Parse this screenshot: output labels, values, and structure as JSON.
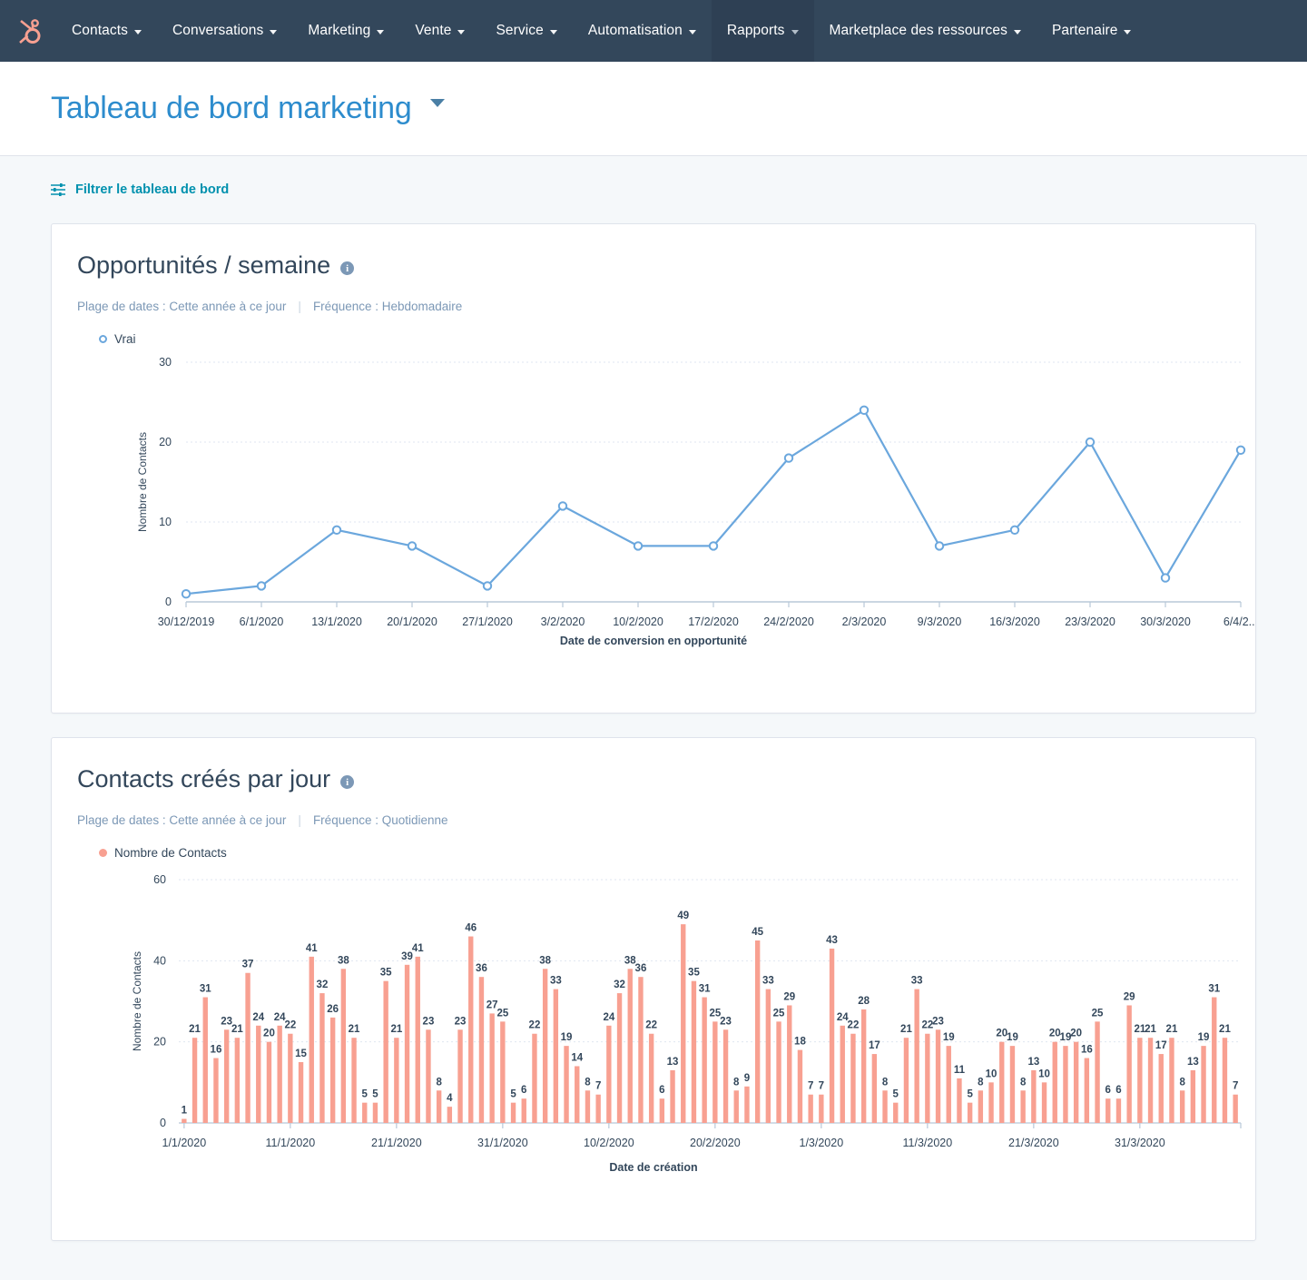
{
  "nav": {
    "logo_name": "hubspot-logo",
    "items": [
      {
        "label": "Contacts",
        "active": false
      },
      {
        "label": "Conversations",
        "active": false
      },
      {
        "label": "Marketing",
        "active": false
      },
      {
        "label": "Vente",
        "active": false
      },
      {
        "label": "Service",
        "active": false
      },
      {
        "label": "Automatisation",
        "active": false
      },
      {
        "label": "Rapports",
        "active": true
      },
      {
        "label": "Marketplace des ressources",
        "active": false
      },
      {
        "label": "Partenaire",
        "active": false
      }
    ]
  },
  "header": {
    "title": "Tableau de bord marketing"
  },
  "filter": {
    "label": "Filtrer le tableau de bord"
  },
  "colors": {
    "nav_bg": "#33475b",
    "nav_active_bg": "#2e4054",
    "title_blue": "#2d8ccd",
    "link_teal": "#0091ae",
    "line_series": "#6ba7dd",
    "bar_series": "#f8a091",
    "text_dark": "#33475b",
    "text_muted": "#7c98b6"
  },
  "cards": [
    {
      "title": "Opportunités / semaine",
      "info_glyph": "i",
      "date_range_label": "Plage de dates : Cette année à ce jour",
      "frequency_label": "Fréquence : Hebdomadaire"
    },
    {
      "title": "Contacts créés par jour",
      "info_glyph": "i",
      "date_range_label": "Plage de dates : Cette année à ce jour",
      "frequency_label": "Fréquence : Quotidienne"
    }
  ],
  "chart_data": [
    {
      "type": "line",
      "title": "Opportunités / semaine",
      "xlabel": "Date de conversion en opportunité",
      "ylabel": "Nombre de Contacts",
      "legend": [
        "Vrai"
      ],
      "legend_position": "top-left",
      "grid": true,
      "ylim": [
        0,
        30
      ],
      "yticks": [
        0,
        10,
        20,
        30
      ],
      "categories": [
        "30/12/2019",
        "6/1/2020",
        "13/1/2020",
        "20/1/2020",
        "27/1/2020",
        "3/2/2020",
        "10/2/2020",
        "17/2/2020",
        "24/2/2020",
        "2/3/2020",
        "9/3/2020",
        "16/3/2020",
        "23/3/2020",
        "30/3/2020",
        "6/4/2..."
      ],
      "series": [
        {
          "name": "Vrai",
          "color": "#6ba7dd",
          "values": [
            1,
            2,
            9,
            7,
            2,
            12,
            7,
            7,
            18,
            24,
            7,
            9,
            20,
            3,
            19
          ]
        }
      ]
    },
    {
      "type": "bar",
      "title": "Contacts créés par jour",
      "xlabel": "Date de création",
      "ylabel": "Nombre de Contacts",
      "legend": [
        "Nombre de Contacts"
      ],
      "legend_position": "top-left",
      "grid": true,
      "ylim": [
        0,
        60
      ],
      "yticks": [
        0,
        20,
        40,
        60
      ],
      "xtick_labels": [
        "1/1/2020",
        "11/1/2020",
        "21/1/2020",
        "31/1/2020",
        "10/2/2020",
        "20/2/2020",
        "1/3/2020",
        "11/3/2020",
        "21/3/2020",
        "31/3/2020"
      ],
      "xtick_indices": [
        0,
        10,
        20,
        30,
        40,
        50,
        60,
        70,
        80,
        90
      ],
      "series": [
        {
          "name": "Nombre de Contacts",
          "color": "#f8a091",
          "values": [
            1,
            21,
            31,
            16,
            23,
            21,
            37,
            24,
            20,
            24,
            22,
            15,
            41,
            32,
            26,
            38,
            21,
            5,
            5,
            35,
            21,
            39,
            41,
            23,
            8,
            4,
            23,
            46,
            36,
            27,
            25,
            5,
            6,
            22,
            38,
            33,
            19,
            14,
            8,
            7,
            24,
            32,
            38,
            36,
            22,
            6,
            13,
            49,
            35,
            31,
            25,
            23,
            8,
            9,
            45,
            33,
            25,
            29,
            18,
            7,
            7,
            43,
            24,
            22,
            28,
            17,
            8,
            5,
            21,
            33,
            22,
            23,
            19,
            11,
            5,
            8,
            10,
            20,
            19,
            8,
            13,
            10,
            20,
            19,
            20,
            16,
            25,
            6,
            6,
            29,
            21,
            21,
            17,
            21,
            8,
            13,
            19,
            31,
            21,
            7
          ]
        }
      ]
    }
  ]
}
